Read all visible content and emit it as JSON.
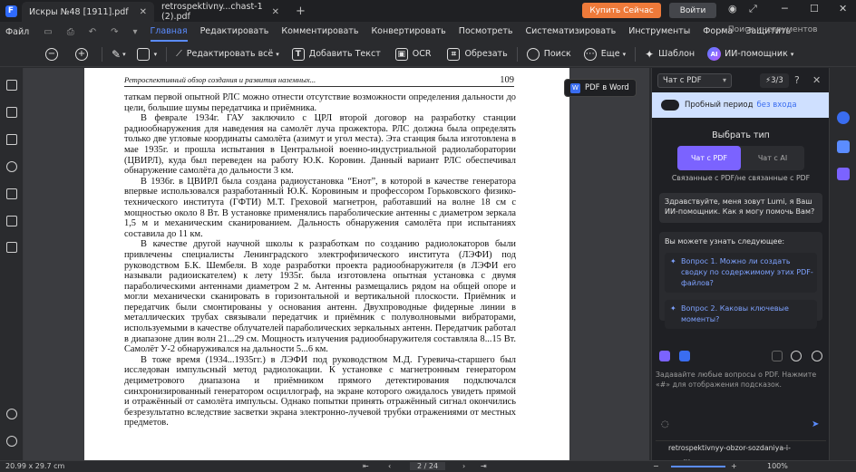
{
  "tabs": {
    "tab1": "Искры №48 [1911].pdf",
    "tab2": "retrospektivny...chast-1 (2).pdf",
    "close": "✕",
    "new": "+"
  },
  "topbar": {
    "buy": "Купить Сейчас",
    "login": "Войти"
  },
  "menu": {
    "file": "Файл",
    "items": [
      "Главная",
      "Редактировать",
      "Комментировать",
      "Конвертировать",
      "Посмотреть",
      "Систематизировать",
      "Инструменты",
      "Форма",
      "Защитить"
    ],
    "search_tools": "Поиск инструментов"
  },
  "toolbar": {
    "edit_all": "Редактировать всё",
    "add_text": "Добавить Текст",
    "ocr": "OCR",
    "crop": "Обрезать",
    "search": "Поиск",
    "more": "Еще",
    "template": "Шаблон",
    "ai": "ИИ-помощник"
  },
  "doc": {
    "running_head": "Ретроспективный обзор создания и развития наземных...",
    "page_number": "109",
    "paragraphs": [
      "таткам первой опытной РЛС можно отнести отсутствие возможности определения дальности до цели, большие шумы передатчика и приёмника.",
      "В феврале 1934г. ГАУ заключило с ЦРЛ второй договор на разработку станции радиообнаружения для наведения на самолёт луча прожектора. РЛС должна была определять только две угловые координаты самолёта (азимут и угол места). Эта станция была изготовлена в мае 1935г. и прошла испытания в Центральной военно-индустриальной радиолаборатории (ЦВИРЛ), куда был переведен на работу Ю.К. Коровин. Данный вариант РЛС обеспечивал обнаружение самолёта до дальности 3 км.",
      "В 1936г. в ЦВИРЛ была создана радиоустановка “Енот”, в которой в качестве генератора впервые использовался разработанный Ю.К. Коровиным и профессором Горьковского физико-технического института (ГФТИ) М.Т. Греховой магнетрон, работавший на волне 18 см с мощностью около 8 Вт. В установке применялись параболические антенны с диаметром зеркала 1,5 м и механическим сканированием. Дальность обнаружения самолёта при испытаниях составила до 11 км.",
      "В качестве другой научной школы к разработкам по созданию радиолокаторов были привлечены специалисты Ленинградского электрофизического института (ЛЭФИ) под руководством Б.К. Шембеля. В ходе разработки проекта радиообнаружителя (в ЛЭФИ его называли радиоискателем) к лету 1935г. была изготовлена опытная установка с двумя параболическими антеннами диаметром 2 м. Антенны размещались рядом на общей опоре и могли механически сканировать в горизонтальной и вертикальной плоскости. Приёмник и передатчик были смонтированы у основания антенн. Двухпроводные фидерные линии в металлических трубах связывали передатчик и приёмник с полуволновыми вибраторами, используемыми в качестве облучателей параболических зеркальных антенн. Передатчик работал в диапазоне длин волн 21...29 см. Мощность излучения радиообнаружителя составляла 8...15 Вт. Самолёт У-2 обнаруживался на дальности 5...6 км.",
      "В тоже время (1934...1935гг.) в ЛЭФИ под руководством М.Д. Гуревича-старшего был исследован импульсный метод радиолокации. К установке с магнетронным генератором дециметрового диапазона и приёмником прямого детектирования подключался синхронизированный генератором осциллограф, на экране которого ожидалось увидеть прямой и отражённый от самолёта импульсы. Однако попытки принять отражённый сигнал окончились безрезультатно вследствие засветки экрана электронно-лучевой трубки отражениями от местных предметов."
    ],
    "pdf_to_word": "PDF в Word"
  },
  "panel": {
    "mode_select": "Чат с PDF",
    "quota": "3/3",
    "trial_text": "Пробный период",
    "trial_link": "без входа",
    "choose_type": "Выбрать тип",
    "seg_pdf": "Чат с PDF",
    "seg_ai": "Чат с AI",
    "related": "Связанные с PDF/не связанные с PDF",
    "greeting": "Здравствуйте, меня зовут Lumi, я Ваш ИИ-помощник. Как я могу помочь Вам?",
    "learn_header": "Вы можете узнать следующее:",
    "q1": "Вопрос 1. Можно ли создать сводку по содержимому этих PDF-файлов?",
    "q2": "Вопрос 2. Каковы ключевые моменты?",
    "prompt": "Задавайте любые вопросы о PDF. Нажмите «#» для отображения подсказок.",
    "file": "retrospektivnyy-obzor-sozdaniya-i-razvitiya-..."
  },
  "status": {
    "page_size": "20.99 x 29.7 cm",
    "page_indicator": "2 / 24",
    "zoom": "100%"
  },
  "colors": {
    "accent": "#5b8cff",
    "buy": "#ee7a3a",
    "segment_active": "#7b63ff"
  }
}
